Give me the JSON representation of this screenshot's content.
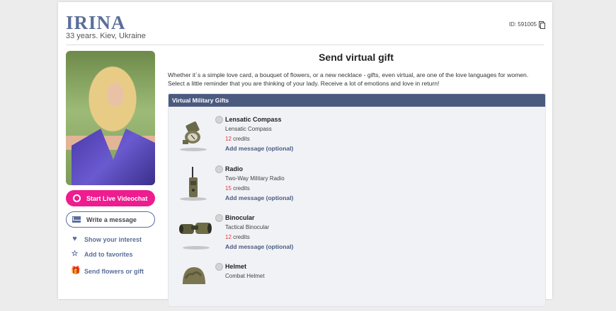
{
  "profile": {
    "name": "IRINA",
    "subtitle": "33 years. Kiev, Ukraine",
    "id_label": "ID: 591005"
  },
  "sidebar": {
    "video_button": "Start Live Videochat",
    "message_button": "Write a message",
    "links": [
      "Show your interest",
      "Add to favorites",
      "Send flowers or gift"
    ]
  },
  "main": {
    "title": "Send virtual gift",
    "intro": "Whether it`s a simple love card, a bouquet of flowers, or a new necklace - gifts, even virtual, are one of the love languages for women. Select a little reminder that you are thinking of your lady. Receive a lot of emotions and love in return!",
    "section_title": "Virtual Military Gifts",
    "gifts": [
      {
        "name": "Lensatic Compass",
        "desc": "Lensatic Compass",
        "credits": "12",
        "credits_label": "credits",
        "add": "Add message (optional)"
      },
      {
        "name": "Radio",
        "desc": "Two-Way Military Radio",
        "credits": "15",
        "credits_label": "credits",
        "add": "Add message (optional)"
      },
      {
        "name": "Binocular",
        "desc": "Tactical Binocular",
        "credits": "12",
        "credits_label": "credits",
        "add": "Add message (optional)"
      },
      {
        "name": "Helmet",
        "desc": "Combat Helmet",
        "credits": "",
        "credits_label": "",
        "add": ""
      }
    ]
  },
  "colors": {
    "accent": "#5a6e9b",
    "video": "#ee1c8f",
    "section_header": "#4b5b80",
    "credits": "#e03a3a"
  },
  "icons": {
    "video": "camera-icon",
    "message": "envelope-icon",
    "interest": "heart-icon",
    "favorite": "star-icon",
    "gift": "gift-icon",
    "copy": "copy-icon"
  }
}
